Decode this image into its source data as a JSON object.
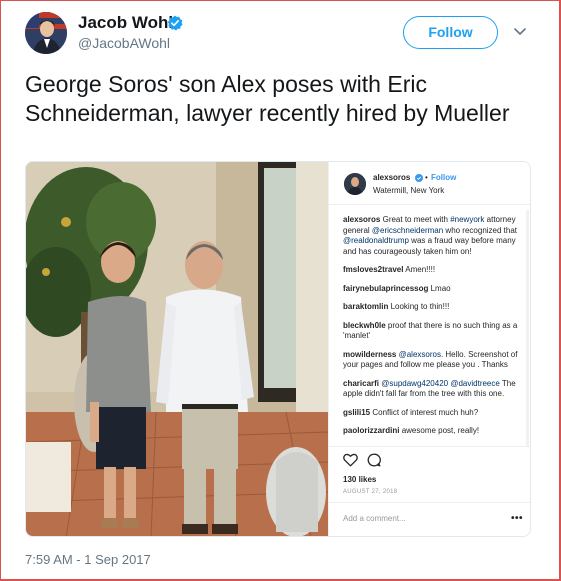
{
  "header": {
    "display_name": "Jacob Wohl",
    "handle": "@JacobAWohl",
    "follow_label": "Follow"
  },
  "tweet": {
    "text": "George Soros' son Alex poses with Eric Schneiderman, lawyer recently hired by Mueller",
    "timestamp": "7:59 AM - 1 Sep 2017"
  },
  "instagram": {
    "username": "alexsoros",
    "dot": "•",
    "follow_label": "Follow",
    "location": "Watermill, New York",
    "comments": [
      {
        "user": "alexsoros",
        "text_parts": [
          "Great to meet with ",
          "#newyork",
          " attorney general ",
          "@ericschneiderman",
          " who recognized that ",
          "@realdonaldtrump",
          " was a fraud way before many and has courageously taken him on!"
        ]
      },
      {
        "user": "fmsloves2travel",
        "text": "Amen!!!!"
      },
      {
        "user": "fairynebulaprincessog",
        "text": "Lmao"
      },
      {
        "user": "baraktomlin",
        "text": "Looking to thin!!!"
      },
      {
        "user": "bleckwh0le",
        "text": "proof that there is no such thing as a 'manlet'"
      },
      {
        "user": "mowilderness",
        "text_parts": [
          "",
          "@alexsoros",
          ". Hello. Screenshot of your pages and follow me please you . Thanks"
        ]
      },
      {
        "user": "charicarfi",
        "text_parts": [
          "",
          "@supdawg420420",
          " ",
          "@davidtreece",
          " The apple didn't fall far from the tree with this one."
        ]
      },
      {
        "user": "gslili15",
        "text": "Conflict of interest much huh?"
      },
      {
        "user": "paolorizzardini",
        "text": "awesome post, really!"
      }
    ],
    "likes": "130 likes",
    "date": "AUGUST 27, 2018",
    "add_comment_placeholder": "Add a comment...",
    "more_glyph": "•••"
  },
  "colors": {
    "twitter_blue": "#1da1f2",
    "instagram_blue": "#3897f0",
    "instagram_tag": "#003569",
    "frame_red": "#d9534f"
  }
}
